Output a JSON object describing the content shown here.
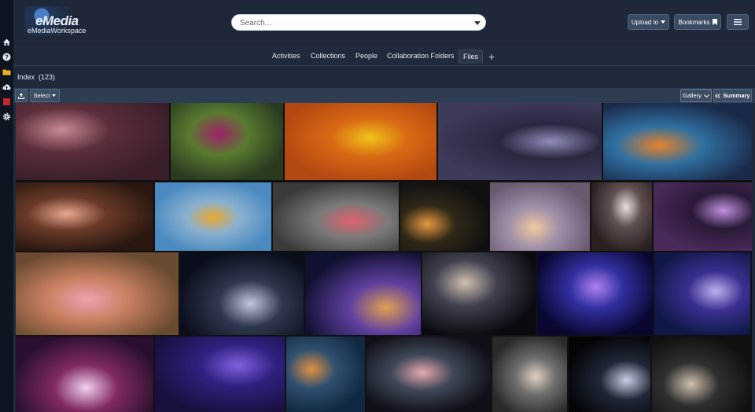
{
  "app": {
    "logo_title": "eMedia",
    "workspace": "eMediaWorkspace"
  },
  "sidebar": {
    "icons": [
      "home-icon",
      "help-icon",
      "folder-icon",
      "cloud-upload-icon",
      "stop-icon",
      "gear-icon"
    ]
  },
  "search": {
    "placeholder": "Search..."
  },
  "header": {
    "upload_label": "Upload to",
    "bookmarks_label": "Bookmarks"
  },
  "tabs": [
    "Activities",
    "Collections",
    "People",
    "Collaboration Folders",
    "Files"
  ],
  "active_tab": "Files",
  "index": {
    "label": "Index",
    "count": "(123)"
  },
  "toolbar": {
    "select_label": "Select",
    "gallery_label": "Gallery",
    "summary_label": "Summary"
  },
  "gallery": {
    "rows": [
      {
        "items": [
          {
            "name": "Pink flowers with buds",
            "colors": [
              "#3a1f2a",
              "#c98a94",
              "#5b2e3a"
            ]
          },
          {
            "name": "Magenta dahlia",
            "colors": [
              "#2a3b20",
              "#a0206a",
              "#5a7a30"
            ]
          },
          {
            "name": "Orange and yellow daisies",
            "colors": [
              "#b34812",
              "#f0c219",
              "#d86a14"
            ]
          },
          {
            "name": "Purple leaves",
            "colors": [
              "#3e3a5a",
              "#8f8db8",
              "#2a2840"
            ]
          },
          {
            "name": "Orange daisy field",
            "colors": [
              "#1a2a4a",
              "#e8822a",
              "#3070a0"
            ]
          }
        ]
      },
      {
        "items": [
          {
            "name": "Flower with dew drop",
            "colors": [
              "#2a1810",
              "#e8a890",
              "#6a3a28"
            ]
          },
          {
            "name": "Yellow flowers blue sky",
            "colors": [
              "#4a8ac0",
              "#e8a830",
              "#8ab0d0"
            ]
          },
          {
            "name": "Pink flower monochrome",
            "colors": [
              "#3a3a3a",
              "#e06070",
              "#7a7a7a"
            ]
          },
          {
            "name": "Orange daisy dark",
            "colors": [
              "#101010",
              "#e89840",
              "#302818"
            ]
          },
          {
            "name": "Pastel daisies",
            "colors": [
              "#6a5a70",
              "#f0c8a0",
              "#a090a8"
            ]
          },
          {
            "name": "White blossoms",
            "colors": [
              "#2a2020",
              "#e8e0e0",
              "#605050"
            ]
          },
          {
            "name": "Purple blossoms",
            "colors": [
              "#4a2a5a",
              "#c090e0",
              "#2a1a38"
            ]
          }
        ]
      },
      {
        "items": [
          {
            "name": "Pink cosmos",
            "colors": [
              "#6a4a30",
              "#f0a0b0",
              "#c88060"
            ]
          },
          {
            "name": "Andromeda galaxy",
            "colors": [
              "#0a0e1a",
              "#c0c8e0",
              "#303850"
            ]
          },
          {
            "name": "Spiral galaxy colorful",
            "colors": [
              "#101030",
              "#e0a050",
              "#6040a0"
            ]
          },
          {
            "name": "Spiral galaxy grey",
            "colors": [
              "#0a0a10",
              "#d0c0b0",
              "#404050"
            ]
          },
          {
            "name": "Purple spiral galaxy",
            "colors": [
              "#0a0830",
              "#b080f0",
              "#3030a0"
            ]
          },
          {
            "name": "Milky Way",
            "colors": [
              "#101848",
              "#c0b0f0",
              "#3a3090"
            ]
          }
        ]
      },
      {
        "items": [
          {
            "name": "Star burst",
            "colors": [
              "#2a1030",
              "#f0d0f0",
              "#802a60"
            ]
          },
          {
            "name": "Purple nebula",
            "colors": [
              "#1a1040",
              "#8060e0",
              "#302080"
            ]
          },
          {
            "name": "Colorful nebula",
            "colors": [
              "#102840",
              "#e09040",
              "#305070"
            ]
          },
          {
            "name": "Galaxy with jet",
            "colors": [
              "#101018",
              "#e8a8b0",
              "#404858"
            ]
          },
          {
            "name": "Galaxy portrait",
            "colors": [
              "#2a2a2a",
              "#e0d0c0",
              "#707070"
            ]
          },
          {
            "name": "Edge-on galaxy",
            "colors": [
              "#050508",
              "#c8d0e8",
              "#202838"
            ]
          },
          {
            "name": "Sombrero galaxy",
            "colors": [
              "#101010",
              "#d0c0b0",
              "#303030"
            ]
          }
        ]
      }
    ]
  }
}
